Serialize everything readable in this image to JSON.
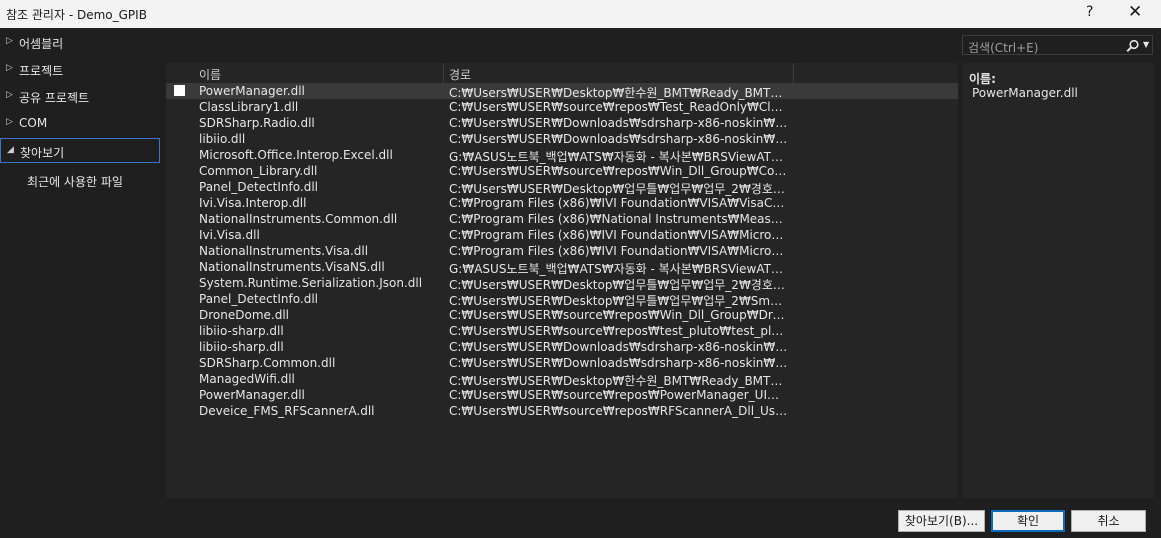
{
  "window": {
    "title": "참조 관리자 - Demo_GPIB",
    "help": "?",
    "close": "✕"
  },
  "sidebar": {
    "items": [
      {
        "arrow": "▷",
        "label": "어셈블리"
      },
      {
        "arrow": "▷",
        "label": "프로젝트"
      },
      {
        "arrow": "▷",
        "label": "공유 프로젝트"
      },
      {
        "arrow": "▷",
        "label": "COM"
      },
      {
        "arrow": "◢",
        "label": "찾아보기"
      }
    ],
    "sub_item": "최근에 사용한 파일"
  },
  "search": {
    "placeholder": "검색(Ctrl+E)",
    "icon": "search-icon"
  },
  "list": {
    "col_name": "이름",
    "col_path": "경로",
    "rows": [
      {
        "name": "PowerManager.dll",
        "path": "C:₩Users₩USER₩Desktop₩한수원_BMT₩Ready_BMT₩Smart...",
        "checked": false
      },
      {
        "name": "ClassLibrary1.dll",
        "path": "C:₩Users₩USER₩source₩repos₩Test_ReadOnly₩ClassLibrary..."
      },
      {
        "name": "SDRSharp.Radio.dll",
        "path": "C:₩Users₩USER₩Downloads₩sdrsharp-x86-noskin₩SDRShar..."
      },
      {
        "name": "libiio.dll",
        "path": "C:₩Users₩USER₩Downloads₩sdrsharp-x86-noskin₩libiio.dll"
      },
      {
        "name": "Microsoft.Office.Interop.Excel.dll",
        "path": "G:₩ASUS노트북_백업₩ATS₩자동화 - 복사본₩BRSViewATS -..."
      },
      {
        "name": "Common_Library.dll",
        "path": "C:₩Users₩USER₩source₩repos₩Win_Dll_Group₩Common_Li..."
      },
      {
        "name": "Panel_DetectInfo.dll",
        "path": "C:₩Users₩USER₩Desktop₩업무틀₩업무₩업무_2₩경호처₩S..."
      },
      {
        "name": "Ivi.Visa.Interop.dll",
        "path": "C:₩Program Files (x86)₩IVI Foundation₩VISA₩VisaCom₩Pri..."
      },
      {
        "name": "NationalInstruments.Common.dll",
        "path": "C:₩Program Files (x86)₩National Instruments₩Measurement..."
      },
      {
        "name": "Ivi.Visa.dll",
        "path": "C:₩Program Files (x86)₩IVI Foundation₩VISA₩Microsoft.NE..."
      },
      {
        "name": "NationalInstruments.Visa.dll",
        "path": "C:₩Program Files (x86)₩IVI Foundation₩VISA₩Microsoft.NE..."
      },
      {
        "name": "NationalInstruments.VisaNS.dll",
        "path": "G:₩ASUS노트북_백업₩ATS₩자동화 - 복사본₩BRSViewATS -..."
      },
      {
        "name": "System.Runtime.Serialization.Json.dll",
        "path": "C:₩Users₩USER₩Desktop₩업무틀₩업무₩업무_2₩경호처₩S..."
      },
      {
        "name": "Panel_DetectInfo.dll",
        "path": "C:₩Users₩USER₩Desktop₩업무틀₩업무₩업무_2₩SmartAnti..."
      },
      {
        "name": "DroneDome.dll",
        "path": "C:₩Users₩USER₩source₩repos₩Win_Dll_Group₩DroneDom..."
      },
      {
        "name": "libiio-sharp.dll",
        "path": "C:₩Users₩USER₩source₩repos₩test_pluto₩test_pluto₩bin₩..."
      },
      {
        "name": "libiio-sharp.dll",
        "path": "C:₩Users₩USER₩Downloads₩sdrsharp-x86-noskin₩libiio-sh..."
      },
      {
        "name": "SDRSharp.Common.dll",
        "path": "C:₩Users₩USER₩Downloads₩sdrsharp-x86-noskin₩SDRShar..."
      },
      {
        "name": "ManagedWifi.dll",
        "path": "C:₩Users₩USER₩Desktop₩한수원_BMT₩Ready_BMT₩Smart..."
      },
      {
        "name": "PowerManager.dll",
        "path": "C:₩Users₩USER₩source₩repos₩PowerManager_UI₩PowerM..."
      },
      {
        "name": "Deveice_FMS_RFScannerA.dll",
        "path": "C:₩Users₩USER₩source₩repos₩RFScannerA_Dll_Usage₩RFS..."
      }
    ]
  },
  "details": {
    "label": "이름:",
    "value": "PowerManager.dll"
  },
  "footer": {
    "browse": "찾아보기(B)...",
    "ok": "확인",
    "cancel": "취소"
  },
  "colors": {
    "accent": "#3a78c6",
    "background": "#1f1f1f",
    "panel": "#252526"
  }
}
